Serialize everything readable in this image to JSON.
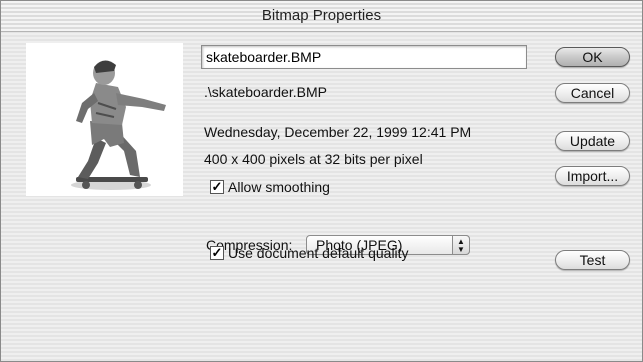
{
  "window": {
    "title": "Bitmap Properties"
  },
  "bitmap": {
    "name": "skateboarder.BMP",
    "path": ".\\skateboarder.BMP",
    "date": "Wednesday, December 22, 1999  12:41 PM",
    "dimensions": "400 x 400 pixels at 32 bits per pixel"
  },
  "options": {
    "allow_smoothing_label": "Allow smoothing",
    "allow_smoothing_checked": true,
    "compression_label": "Compression:",
    "compression_value": "Photo (JPEG)",
    "default_quality_label": "Use document default quality",
    "default_quality_checked": true
  },
  "buttons": {
    "ok": "OK",
    "cancel": "Cancel",
    "update": "Update",
    "import": "Import...",
    "test": "Test"
  },
  "icons": {
    "check": "checkmark-icon",
    "select_arrows": "updown-arrows-icon"
  }
}
